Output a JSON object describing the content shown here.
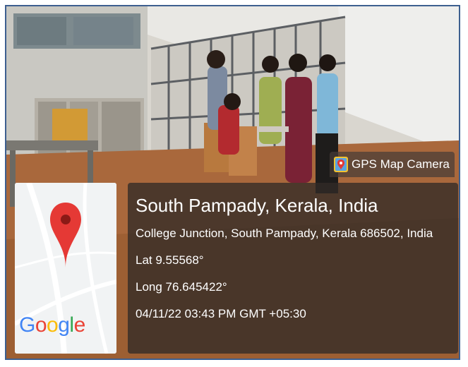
{
  "app_badge": {
    "name": "GPS Map Camera",
    "icon": "gps-map-camera-icon"
  },
  "location": {
    "title": "South Pampady, Kerala, India",
    "address": "College Junction, South Pampady, Kerala 686502, India",
    "lat": "Lat 9.55568°",
    "long": "Long 76.645422°",
    "datetime": "04/11/22 03:43 PM GMT +05:30"
  },
  "map": {
    "logo_text": "Google",
    "pin_icon": "map-pin-icon",
    "pin_color": "#e53935"
  },
  "colors": {
    "frame_border": "#3d5f8f",
    "overlay_bg": "#322a26"
  }
}
